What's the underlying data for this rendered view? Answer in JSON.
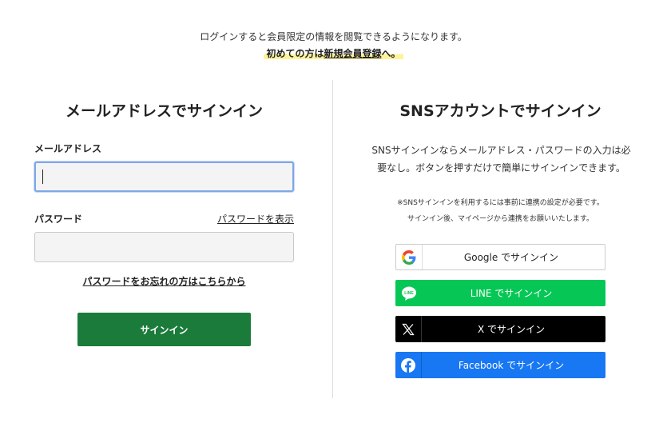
{
  "notice": {
    "line1": "ログインすると会員限定の情報を閲覧できるようになります。",
    "line2_prefix": "初めての方は",
    "line2_link": "新規会員登録",
    "line2_suffix": "へ。"
  },
  "email_signin": {
    "title": "メールアドレスでサインイン",
    "email_label": "メールアドレス",
    "email_value": "",
    "password_label": "パスワード",
    "password_value": "",
    "show_password": "パスワードを表示",
    "forgot_password": "パスワードをお忘れの方はこちらから",
    "submit_label": "サインイン"
  },
  "sns_signin": {
    "title": "SNSアカウントでサインイン",
    "description_line1": "SNSサインインならメールアドレス・パスワードの入力は必",
    "description_line2": "要なし。ボタンを押すだけで簡単にサインインできます。",
    "note_line1": "※SNSサインインを利用するには事前に連携の設定が必要です。",
    "note_line2": "サインイン後、マイページから連携をお願いいたします。",
    "buttons": [
      {
        "label": "Google でサインイン",
        "icon": "google-icon",
        "color": "#ffffff"
      },
      {
        "label": "LINE でサインイン",
        "icon": "line-icon",
        "color": "#06c755"
      },
      {
        "label": "X でサインイン",
        "icon": "x-icon",
        "color": "#000000"
      },
      {
        "label": "Facebook でサインイン",
        "icon": "facebook-icon",
        "color": "#1877f2"
      }
    ]
  },
  "colors": {
    "signin_button": "#1b7b3a",
    "highlight": "#fff39a",
    "focus_border": "#7fa7e8"
  }
}
